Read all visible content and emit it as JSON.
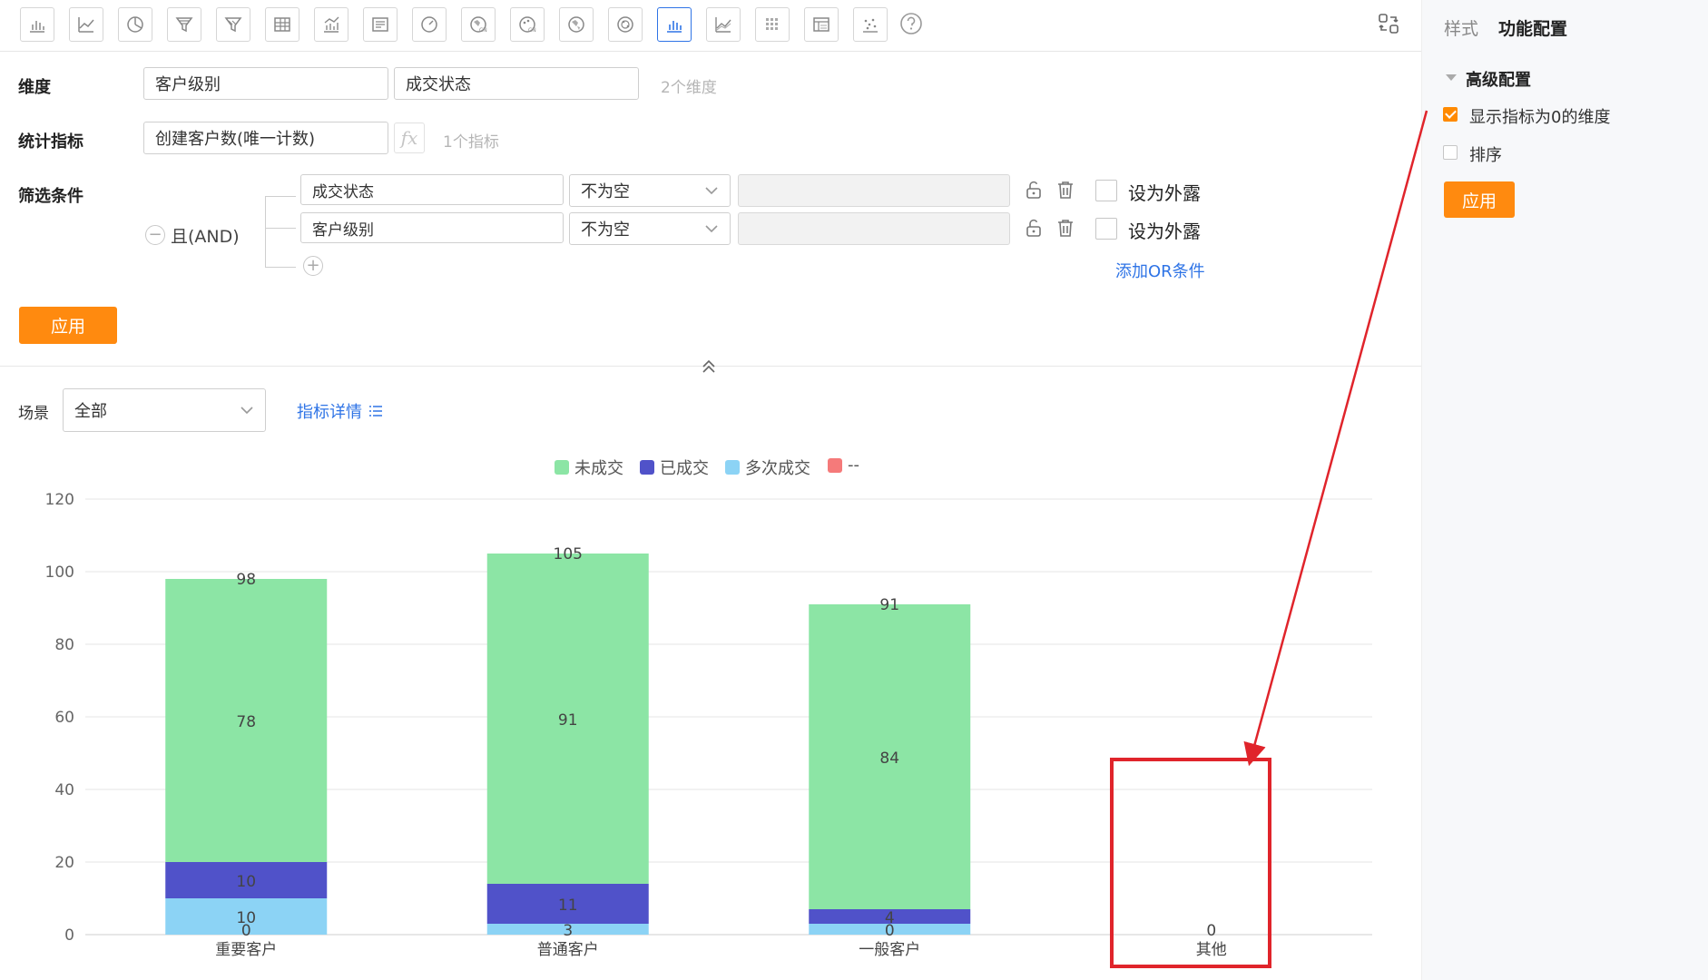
{
  "toolbar": {
    "icons": [
      "bar-chart-icon",
      "line-chart-icon",
      "pie-chart-icon",
      "funnel-icon",
      "funnel-compare-icon",
      "table-icon",
      "combo-chart-icon",
      "text-card-icon",
      "gauge-icon",
      "china-map-icon",
      "china-scatter-map-icon",
      "world-map-icon",
      "radar-icon",
      "stacked-bar-icon",
      "area-chart-icon",
      "heatmap-icon",
      "pivot-table-icon",
      "scatter-icon"
    ],
    "active_index": 13
  },
  "right_panel": {
    "tab_style": "样式",
    "tab_function": "功能配置",
    "section_title": "高级配置",
    "option_show_zero": "显示指标为0的维度",
    "option_show_zero_checked": true,
    "option_sort": "排序",
    "option_sort_checked": false,
    "apply_label": "应用"
  },
  "config": {
    "dimension_label": "维度",
    "dimension_1": "客户级别",
    "dimension_2": "成交状态",
    "dimension_count": "2个维度",
    "metric_label": "统计指标",
    "metric_1": "创建客户数(唯一计数)",
    "fx_label": "fx",
    "metric_count": "1个指标",
    "filter_label": "筛选条件",
    "logic_label": "且(AND)",
    "filters": [
      {
        "field": "成交状态",
        "operator": "不为空",
        "external_label": "设为外露"
      },
      {
        "field": "客户级别",
        "operator": "不为空",
        "external_label": "设为外露"
      }
    ],
    "add_or_label": "添加OR条件",
    "apply_label": "应用"
  },
  "scene": {
    "label": "场景",
    "value": "全部",
    "metric_detail_link": "指标详情"
  },
  "colors": {
    "accent_orange": "#ff8a0f",
    "link_blue": "#2f74e6",
    "annotation_red": "#e0242b"
  },
  "chart_data": {
    "type": "bar",
    "stacked": true,
    "categories": [
      "重要客户",
      "普通客户",
      "一般客户",
      "其他"
    ],
    "series": [
      {
        "name": "多次成交",
        "color": "#8cd3f5",
        "values": [
          10,
          3,
          3,
          0
        ],
        "labels": [
          "10",
          "3",
          "",
          ""
        ]
      },
      {
        "name": "已成交",
        "color": "#5052c9",
        "values": [
          10,
          11,
          4,
          0
        ],
        "labels": [
          "10",
          "11",
          "4",
          ""
        ]
      },
      {
        "name": "未成交",
        "color": "#8ce5a5",
        "values": [
          78,
          91,
          84,
          0
        ],
        "labels": [
          "78",
          "91",
          "84",
          ""
        ]
      },
      {
        "name": "--",
        "color": "#f57a7a",
        "values": [
          0,
          0,
          0,
          0
        ],
        "labels": [
          "",
          "",
          "",
          ""
        ]
      }
    ],
    "bottom_labels": [
      "0",
      "",
      "0",
      "0"
    ],
    "totals": [
      "98",
      "105",
      "91",
      ""
    ],
    "legend_order": [
      "未成交",
      "已成交",
      "多次成交",
      "--"
    ],
    "ylim": [
      0,
      120
    ],
    "yticks": [
      0,
      20,
      40,
      60,
      80,
      100,
      120
    ],
    "grid": true,
    "legend_position": "top-center"
  }
}
